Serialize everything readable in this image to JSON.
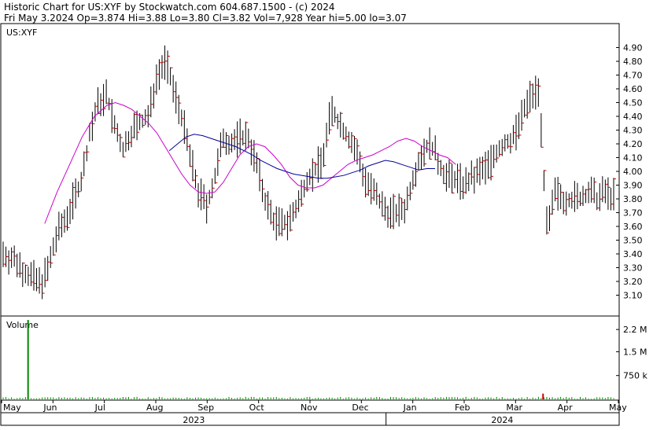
{
  "header": {
    "line1": "Historic Chart for US:XYF by Stockwatch.com 604.687.1500 - (c) 2024",
    "line2": "Fri May  3.2024  Op=3.874  Hi=3.88  Lo=3.80  Cl=3.82  Vol=7,928  Year hi=5.00  lo=3.07"
  },
  "panels": {
    "price_label": "US:XYF",
    "volume_label": "Volume"
  },
  "colors": {
    "background": "#ffffff",
    "frame": "#000000",
    "bars": "#000000",
    "close_tick": "#cc0000",
    "ma_fast": "#cc00cc",
    "ma_slow": "#000099",
    "volume": "#008800"
  },
  "chart_data": [
    {
      "type": "ohlc",
      "ticker": "US:XYF",
      "ylim": [
        3.0,
        5.0
      ],
      "y_ticks": [
        "3.10",
        "3.20",
        "3.30",
        "3.40",
        "3.50",
        "3.60",
        "3.70",
        "3.80",
        "3.90",
        "4.00",
        "4.10",
        "4.20",
        "4.30",
        "4.40",
        "4.50",
        "4.60",
        "4.70",
        "4.80",
        "4.90"
      ],
      "x_months": [
        "May",
        "Jun",
        "Jul",
        "Aug",
        "Sep",
        "Oct",
        "Nov",
        "Dec",
        "Jan",
        "Feb",
        "Mar",
        "Apr",
        "May"
      ],
      "x_years": [
        "2023",
        "2024"
      ],
      "latest": {
        "date": "Fri May  3.2024",
        "open": 3.874,
        "high": 3.88,
        "low": 3.8,
        "close": 3.82,
        "volume": 7928
      },
      "year_range": {
        "high": 5.0,
        "low": 3.07
      },
      "series_points": [
        [
          0,
          3.4
        ],
        [
          3,
          3.35
        ],
        [
          6,
          3.25
        ],
        [
          9,
          3.18
        ],
        [
          11,
          3.3
        ],
        [
          13,
          3.55
        ],
        [
          15,
          3.65
        ],
        [
          17,
          3.8
        ],
        [
          19,
          3.95
        ],
        [
          21,
          4.3
        ],
        [
          23,
          4.5
        ],
        [
          25,
          4.55
        ],
        [
          27,
          4.3
        ],
        [
          29,
          4.15
        ],
        [
          31,
          4.3
        ],
        [
          33,
          4.35
        ],
        [
          35,
          4.4
        ],
        [
          37,
          4.7
        ],
        [
          39,
          4.8
        ],
        [
          41,
          4.6
        ],
        [
          43,
          4.4
        ],
        [
          45,
          4.1
        ],
        [
          47,
          3.85
        ],
        [
          49,
          3.75
        ],
        [
          51,
          3.95
        ],
        [
          53,
          4.25
        ],
        [
          55,
          4.2
        ],
        [
          57,
          4.25
        ],
        [
          59,
          4.25
        ],
        [
          61,
          4.05
        ],
        [
          63,
          3.8
        ],
        [
          65,
          3.65
        ],
        [
          67,
          3.6
        ],
        [
          69,
          3.65
        ],
        [
          71,
          3.75
        ],
        [
          73,
          3.95
        ],
        [
          75,
          4.0
        ],
        [
          77,
          4.1
        ],
        [
          79,
          4.45
        ],
        [
          81,
          4.35
        ],
        [
          83,
          4.25
        ],
        [
          85,
          4.15
        ],
        [
          87,
          3.95
        ],
        [
          89,
          3.85
        ],
        [
          91,
          3.75
        ],
        [
          93,
          3.7
        ],
        [
          95,
          3.7
        ],
        [
          97,
          3.75
        ],
        [
          99,
          4.0
        ],
        [
          101,
          4.15
        ],
        [
          103,
          4.2
        ],
        [
          105,
          4.05
        ],
        [
          107,
          3.95
        ],
        [
          109,
          3.95
        ],
        [
          111,
          3.9
        ],
        [
          113,
          3.95
        ],
        [
          115,
          4.0
        ],
        [
          117,
          4.05
        ],
        [
          119,
          4.15
        ],
        [
          121,
          4.2
        ],
        [
          123,
          4.25
        ],
        [
          125,
          4.4
        ],
        [
          127,
          4.55
        ],
        [
          129,
          4.6
        ],
        [
          131,
          3.55
        ],
        [
          133,
          3.85
        ],
        [
          135,
          3.8
        ],
        [
          137,
          3.8
        ],
        [
          139,
          3.8
        ],
        [
          141,
          3.85
        ],
        [
          143,
          3.8
        ],
        [
          145,
          3.85
        ],
        [
          147,
          3.82
        ]
      ],
      "ma_fast": [
        [
          10,
          3.62
        ],
        [
          13,
          3.85
        ],
        [
          16,
          4.05
        ],
        [
          19,
          4.25
        ],
        [
          22,
          4.4
        ],
        [
          25,
          4.48
        ],
        [
          27,
          4.5
        ],
        [
          29,
          4.48
        ],
        [
          31,
          4.45
        ],
        [
          33,
          4.4
        ],
        [
          35,
          4.35
        ],
        [
          37,
          4.28
        ],
        [
          39,
          4.18
        ],
        [
          41,
          4.08
        ],
        [
          43,
          3.98
        ],
        [
          45,
          3.9
        ],
        [
          47,
          3.85
        ],
        [
          49,
          3.84
        ],
        [
          51,
          3.85
        ],
        [
          53,
          3.92
        ],
        [
          55,
          4.02
        ],
        [
          57,
          4.12
        ],
        [
          59,
          4.18
        ],
        [
          61,
          4.2
        ],
        [
          63,
          4.18
        ],
        [
          65,
          4.12
        ],
        [
          67,
          4.05
        ],
        [
          69,
          3.96
        ],
        [
          71,
          3.9
        ],
        [
          73,
          3.88
        ],
        [
          75,
          3.88
        ],
        [
          77,
          3.9
        ],
        [
          79,
          3.95
        ],
        [
          81,
          4.0
        ],
        [
          83,
          4.05
        ],
        [
          85,
          4.08
        ],
        [
          87,
          4.1
        ],
        [
          89,
          4.12
        ],
        [
          91,
          4.15
        ],
        [
          93,
          4.18
        ],
        [
          95,
          4.22
        ],
        [
          97,
          4.24
        ],
        [
          99,
          4.22
        ],
        [
          101,
          4.18
        ],
        [
          103,
          4.15
        ],
        [
          105,
          4.12
        ],
        [
          107,
          4.1
        ],
        [
          109,
          4.05
        ]
      ],
      "ma_slow": [
        [
          40,
          4.15
        ],
        [
          42,
          4.2
        ],
        [
          44,
          4.25
        ],
        [
          46,
          4.27
        ],
        [
          48,
          4.26
        ],
        [
          50,
          4.24
        ],
        [
          52,
          4.22
        ],
        [
          54,
          4.2
        ],
        [
          56,
          4.18
        ],
        [
          58,
          4.15
        ],
        [
          60,
          4.12
        ],
        [
          62,
          4.08
        ],
        [
          64,
          4.05
        ],
        [
          66,
          4.02
        ],
        [
          68,
          4.0
        ],
        [
          70,
          3.98
        ],
        [
          72,
          3.97
        ],
        [
          74,
          3.96
        ],
        [
          76,
          3.95
        ],
        [
          78,
          3.95
        ],
        [
          80,
          3.96
        ],
        [
          82,
          3.97
        ],
        [
          84,
          3.99
        ],
        [
          86,
          4.01
        ],
        [
          88,
          4.04
        ],
        [
          90,
          4.06
        ],
        [
          92,
          4.08
        ],
        [
          94,
          4.07
        ],
        [
          96,
          4.05
        ],
        [
          98,
          4.03
        ],
        [
          100,
          4.01
        ],
        [
          102,
          4.02
        ],
        [
          104,
          4.02
        ]
      ],
      "volume": {
        "ticks": [
          "2.2 M",
          "1.5 M",
          "750 k"
        ],
        "tick_values": [
          2200000,
          1500000,
          750000
        ],
        "ylim": [
          0,
          2600000
        ],
        "spike": {
          "month": "May",
          "value": 2500000
        }
      }
    }
  ]
}
